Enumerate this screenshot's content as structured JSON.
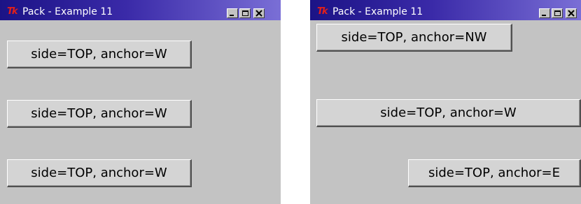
{
  "left_window": {
    "title": "Pack - Example 11",
    "logo": "Tk",
    "buttons": [
      {
        "label": "side=TOP, anchor=W"
      },
      {
        "label": "side=TOP, anchor=W"
      },
      {
        "label": "side=TOP, anchor=W"
      }
    ]
  },
  "right_window": {
    "title": "Pack - Example 11",
    "logo": "Tk",
    "buttons": [
      {
        "label": "side=TOP, anchor=NW"
      },
      {
        "label": "side=TOP, anchor=W"
      },
      {
        "label": "side=TOP, anchor=E"
      }
    ]
  },
  "icons": [
    "tk-logo-icon",
    "minimize-icon",
    "maximize-icon",
    "close-icon"
  ],
  "colors": {
    "window_bg": "#c3c3c3",
    "titlebar_start": "#1b1386",
    "titlebar_end": "#7a6fd6",
    "title_text": "#ffffff",
    "logo": "#e0201a"
  }
}
